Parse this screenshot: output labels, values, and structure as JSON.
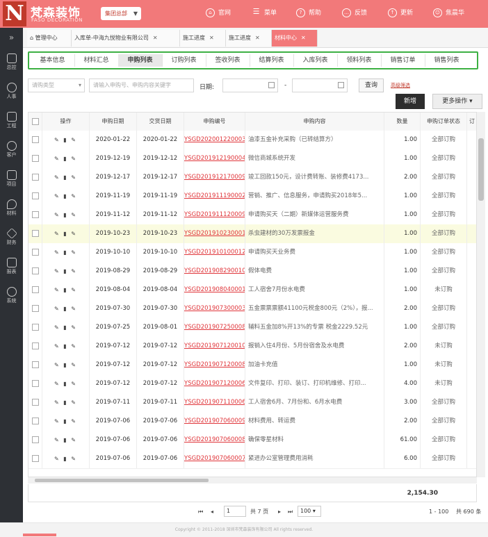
{
  "header": {
    "logo_letter": "N",
    "brand_cn": "梵森装饰",
    "brand_en": "FASO DECORATION",
    "group_select": "集团总部",
    "nav": [
      "官网",
      "菜单",
      "帮助",
      "反馈",
      "更新",
      "焦晨华"
    ],
    "colors": {
      "header_bg": "#f2797a",
      "sidebar_bg": "#2d3035",
      "active_tab": "#f2797a",
      "highlight_border": "#3cb043",
      "link": "#e0353a"
    }
  },
  "sidebar": {
    "toggle": "»",
    "items": [
      "总控",
      "人事",
      "工程",
      "客户",
      "项目",
      "材料",
      "财务",
      "报表",
      "系统"
    ]
  },
  "tabs": [
    {
      "label": "管理中心",
      "closable": false,
      "active": false
    },
    {
      "label": "入库单-中海九悦物业有限公司",
      "closable": true,
      "active": false
    },
    {
      "label": "施工进度",
      "closable": true,
      "active": false
    },
    {
      "label": "施工进度",
      "closable": true,
      "active": false
    },
    {
      "label": "材料中心",
      "closable": true,
      "active": true
    }
  ],
  "subnav": {
    "items": [
      "基本信息",
      "材料汇总",
      "申购列表",
      "订购列表",
      "签收列表",
      "结算列表",
      "入库列表",
      "领料列表",
      "销售订单",
      "销售列表"
    ],
    "active_index": 2
  },
  "filters": {
    "type_select": "请购类型",
    "keyword_placeholder": "请输入申购号、申购内容关键字",
    "date_label": "日期:",
    "date_sep": "-",
    "query_button": "查询",
    "advanced_link": "高级筛选",
    "new_button": "新增",
    "more_button": "更多操作"
  },
  "table": {
    "columns": [
      "",
      "操作",
      "申购日期",
      "交货日期",
      "申购编号",
      "申购内容",
      "数量",
      "申购订单状态",
      "订"
    ],
    "rows": [
      {
        "date": "2020-01-22",
        "delivery": "2020-01-22",
        "code": "YSGD202001220003",
        "content": "油漆五金补充采购（已转结算方）",
        "qty": "1.00",
        "status": "全部订购",
        "hl": false
      },
      {
        "date": "2019-12-19",
        "delivery": "2019-12-12",
        "code": "YSGD201912190004",
        "content": "微信商城系统开发",
        "qty": "1.00",
        "status": "全部订购",
        "hl": false
      },
      {
        "date": "2019-12-17",
        "delivery": "2019-12-17",
        "code": "YSGD201912170009",
        "content": "竣工回款150元，设计费转账、装修费4173...",
        "qty": "2.00",
        "status": "全部订购",
        "hl": false
      },
      {
        "date": "2019-11-19",
        "delivery": "2019-11-19",
        "code": "YSGD201911190002",
        "content": "营销、推广、信息服务，申请购买2018年5...",
        "qty": "1.00",
        "status": "全部订购",
        "hl": false
      },
      {
        "date": "2019-11-12",
        "delivery": "2019-11-12",
        "code": "YSGD201911120009",
        "content": "申请购买天（二期）新媒体运营服务费",
        "qty": "1.00",
        "status": "全部订购",
        "hl": false
      },
      {
        "date": "2019-10-23",
        "delivery": "2019-10-23",
        "code": "YSGD201910230001",
        "content": "杀虫建材的30万发票报金",
        "qty": "1.00",
        "status": "全部订购",
        "hl": true
      },
      {
        "date": "2019-10-10",
        "delivery": "2019-10-10",
        "code": "YSGD201910100012",
        "content": "申请购买天业务费",
        "qty": "1.00",
        "status": "全部订购",
        "hl": false
      },
      {
        "date": "2019-08-29",
        "delivery": "2019-08-29",
        "code": "YSGD201908290010",
        "content": "假体电费",
        "qty": "1.00",
        "status": "全部订购",
        "hl": false
      },
      {
        "date": "2019-08-04",
        "delivery": "2019-08-04",
        "code": "YSGD201908040001",
        "content": "工人宿舍7月份水电费",
        "qty": "1.00",
        "status": "未订购",
        "hl": false
      },
      {
        "date": "2019-07-30",
        "delivery": "2019-07-30",
        "code": "YSGD201907300003",
        "content": "五金票票票额41100元税金800元（2%），报...",
        "qty": "2.00",
        "status": "全部订购",
        "hl": false
      },
      {
        "date": "2019-07-25",
        "delivery": "2019-08-01",
        "code": "YSGD201907250008",
        "content": "辅料五金加8%开13%的专票 税金2229.52元",
        "qty": "1.00",
        "status": "全部订购",
        "hl": false
      },
      {
        "date": "2019-07-12",
        "delivery": "2019-07-12",
        "code": "YSGD201907120010",
        "content": "报销入住4月份、5月份宿舍及水电费",
        "qty": "2.00",
        "status": "未订购",
        "hl": false
      },
      {
        "date": "2019-07-12",
        "delivery": "2019-07-12",
        "code": "YSGD201907120008",
        "content": "加油卡充值",
        "qty": "1.00",
        "status": "未订购",
        "hl": false
      },
      {
        "date": "2019-07-12",
        "delivery": "2019-07-12",
        "code": "YSGD201907120006",
        "content": "文件复印、打印、装订、打印机维修、打印...",
        "qty": "4.00",
        "status": "未订购",
        "hl": false
      },
      {
        "date": "2019-07-11",
        "delivery": "2019-07-11",
        "code": "YSGD201907110006",
        "content": "工人宿舍6月、7月份和、6月水电费",
        "qty": "3.00",
        "status": "全部订购",
        "hl": false
      },
      {
        "date": "2019-07-06",
        "delivery": "2019-07-06",
        "code": "YSGD201907060009",
        "content": "材料费用、转运费",
        "qty": "2.00",
        "status": "全部订购",
        "hl": false
      },
      {
        "date": "2019-07-06",
        "delivery": "2019-07-06",
        "code": "YSGD201907060008",
        "content": "确保零星材料",
        "qty": "61.00",
        "status": "全部订购",
        "hl": false
      },
      {
        "date": "2019-07-06",
        "delivery": "2019-07-06",
        "code": "YSGD201907060007",
        "content": "紧进办公室管理费用消耗",
        "qty": "6.00",
        "status": "全部订购",
        "hl": false
      }
    ],
    "total": "2,154.30",
    "action_icons": [
      "edit-icon",
      "trash-icon",
      "attach-icon"
    ]
  },
  "pager": {
    "first": "⏮",
    "prev": "◂",
    "current_page": "1",
    "total_pages_text": "共 7 页",
    "next": "▸",
    "last": "⏭",
    "page_size": "100",
    "range_text": "1 - 100",
    "total_text": "共 690 条"
  },
  "footer": {
    "copyright": "Copyright © 2011-2018 深圳市梵森装饰有限公司 All rights reserved."
  }
}
